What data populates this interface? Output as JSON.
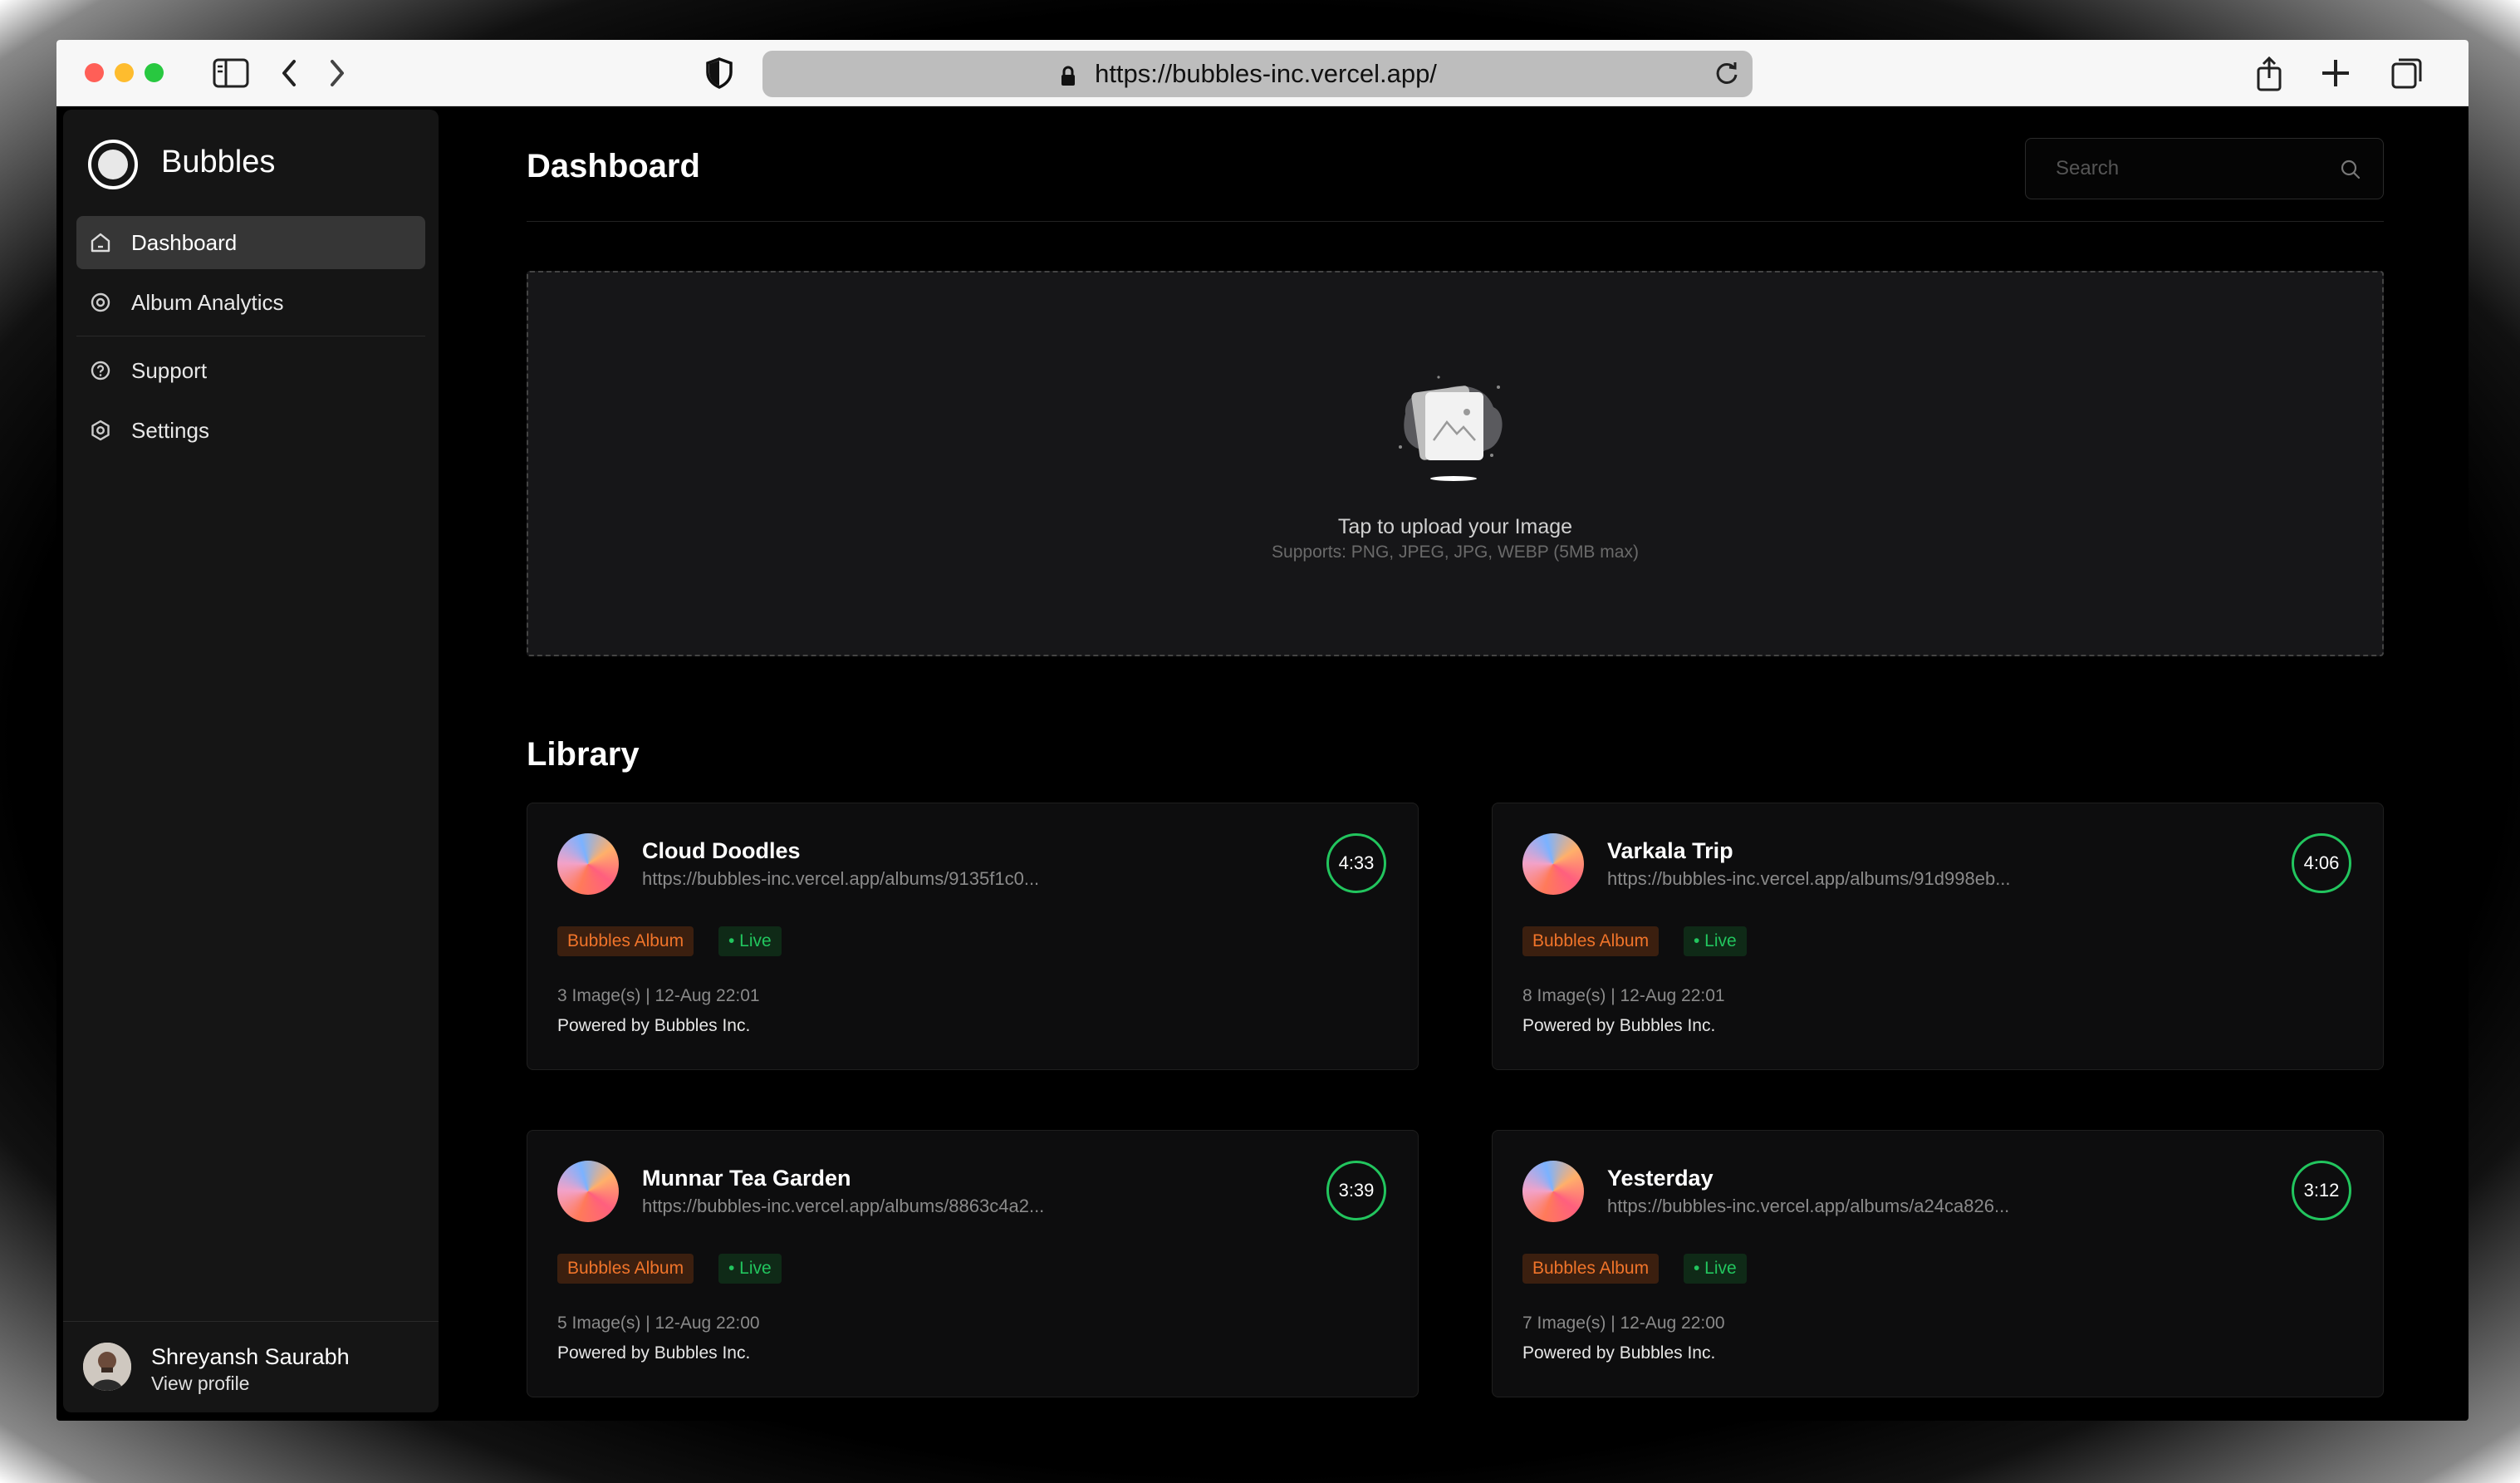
{
  "browser": {
    "url": "https://bubbles-inc.vercel.app/"
  },
  "sidebar": {
    "brand": "Bubbles",
    "items": [
      {
        "label": "Dashboard",
        "icon": "home-icon",
        "active": true
      },
      {
        "label": "Album Analytics",
        "icon": "target-icon",
        "active": false
      },
      {
        "label": "Support",
        "icon": "help-circle-icon",
        "active": false
      },
      {
        "label": "Settings",
        "icon": "gear-icon",
        "active": false
      }
    ],
    "user": {
      "name": "Shreyansh Saurabh",
      "link": "View profile"
    }
  },
  "main": {
    "title": "Dashboard",
    "search": {
      "placeholder": "Search"
    },
    "upload": {
      "title": "Tap to upload your Image",
      "subtitle": "Supports: PNG, JPEG, JPG, WEBP (5MB max)"
    },
    "library_title": "Library",
    "albums": [
      {
        "title": "Cloud Doodles",
        "url": "https://bubbles-inc.vercel.app/albums/9135f1c0...",
        "timer": "4:33",
        "tag": "Bubbles Album",
        "status": "• Live",
        "meta": "3 Image(s) | 12-Aug 22:01",
        "footer": "Powered by Bubbles Inc."
      },
      {
        "title": "Varkala Trip",
        "url": "https://bubbles-inc.vercel.app/albums/91d998eb...",
        "timer": "4:06",
        "tag": "Bubbles Album",
        "status": "• Live",
        "meta": "8 Image(s) | 12-Aug 22:01",
        "footer": "Powered by Bubbles Inc."
      },
      {
        "title": "Munnar Tea Garden",
        "url": "https://bubbles-inc.vercel.app/albums/8863c4a2...",
        "timer": "3:39",
        "tag": "Bubbles Album",
        "status": "• Live",
        "meta": "5 Image(s) | 12-Aug 22:00",
        "footer": "Powered by Bubbles Inc."
      },
      {
        "title": "Yesterday",
        "url": "https://bubbles-inc.vercel.app/albums/a24ca826...",
        "timer": "3:12",
        "tag": "Bubbles Album",
        "status": "• Live",
        "meta": "7 Image(s) | 12-Aug 22:00",
        "footer": "Powered by Bubbles Inc."
      }
    ]
  },
  "colors": {
    "accent_green": "#22c55e",
    "tag_orange": "#f0742a",
    "background": "#000000",
    "sidebar": "#151515"
  }
}
